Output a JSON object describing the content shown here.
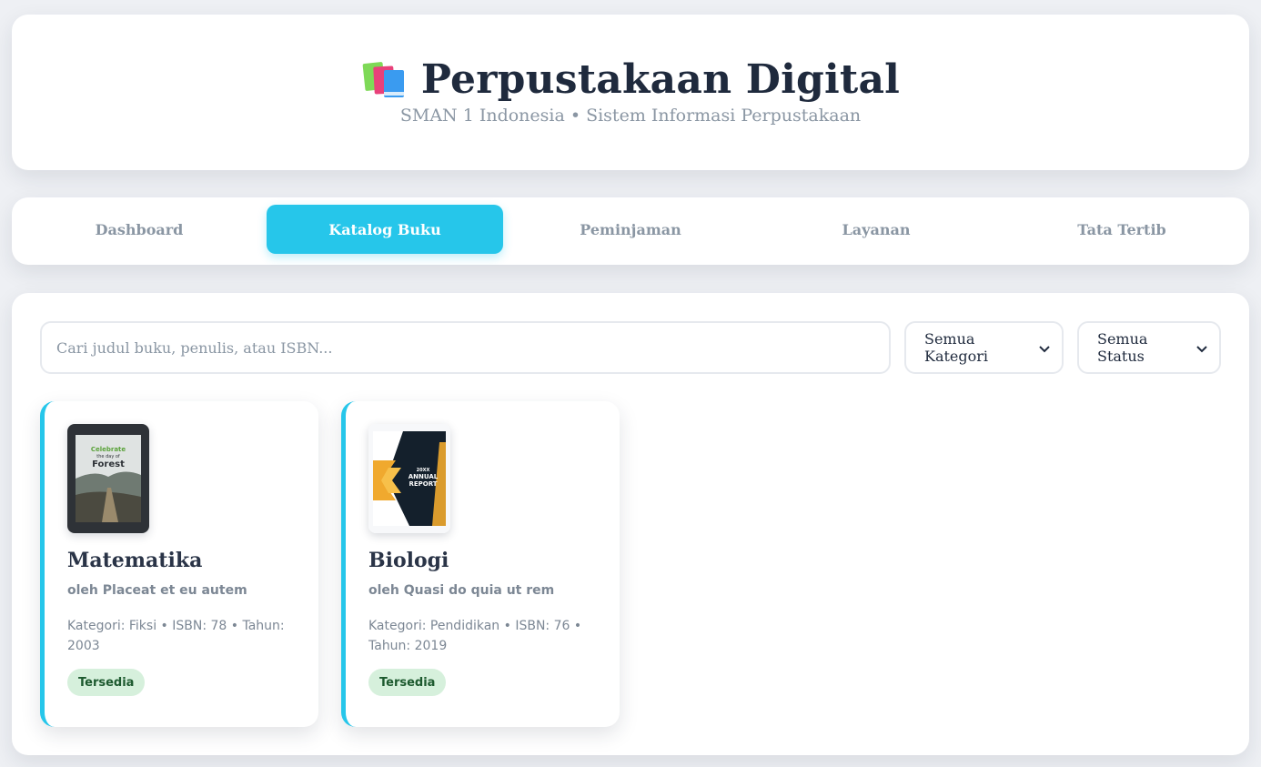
{
  "header": {
    "icon": "books-icon",
    "title": "Perpustakaan Digital",
    "subtitle": "SMAN 1 Indonesia • Sistem Informasi Perpustakaan"
  },
  "nav": {
    "tabs": [
      {
        "label": "Dashboard",
        "active": false
      },
      {
        "label": "Katalog Buku",
        "active": true
      },
      {
        "label": "Peminjaman",
        "active": false
      },
      {
        "label": "Layanan",
        "active": false
      },
      {
        "label": "Tata Tertib",
        "active": false
      }
    ]
  },
  "filters": {
    "search_placeholder": "Cari judul buku, penulis, atau ISBN...",
    "category_selected": "Semua Kategori",
    "status_selected": "Semua Status"
  },
  "books": [
    {
      "title": "Matematika",
      "author": "oleh Placeat et eu autem",
      "meta": "Kategori: Fiksi • ISBN: 78 • Tahun: 2003",
      "status": "Tersedia",
      "cover": {
        "line1": "Celebrate",
        "line2": "the day of",
        "line3": "Forest"
      }
    },
    {
      "title": "Biologi",
      "author": "oleh Quasi do quia ut rem",
      "meta": "Kategori: Pendidikan • ISBN: 76 • Tahun: 2019",
      "status": "Tersedia",
      "cover": {
        "line1": "20XX",
        "line2": "ANNUAL",
        "line3": "REPORT"
      }
    }
  ],
  "colors": {
    "accent": "#26c6ea",
    "badge_bg": "#d6f0dc",
    "badge_text": "#1d5a2f"
  }
}
